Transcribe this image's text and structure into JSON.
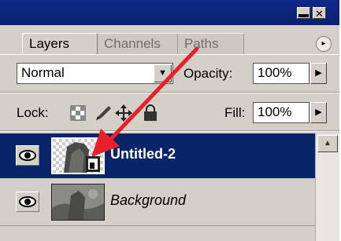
{
  "window": {
    "minimize_symbol": "▬",
    "close_symbol": "✕"
  },
  "tabs": [
    {
      "label": "Layers"
    },
    {
      "label": "Channels"
    },
    {
      "label": "Paths"
    }
  ],
  "panel_menu_symbol": "▸",
  "blend_mode": {
    "value": "Normal"
  },
  "opacity": {
    "label": "Opacity:",
    "value": "100%"
  },
  "lock": {
    "label": "Lock:"
  },
  "fill": {
    "label": "Fill:",
    "value": "100%"
  },
  "layers": [
    {
      "name": "Untitled-2",
      "selected": true
    },
    {
      "name": "Background",
      "selected": false
    }
  ],
  "colors": {
    "title_bar": "#0a2170",
    "selection": "#0a246a",
    "annotation_arrow": "#e8202a"
  },
  "icons": [
    "minimize-icon",
    "close-icon",
    "panel-menu-icon",
    "dropdown-arrow-icon",
    "eye-icon",
    "lock-transparent-icon",
    "lock-brush-icon",
    "lock-move-icon",
    "lock-all-icon",
    "layer-mask-icon"
  ]
}
